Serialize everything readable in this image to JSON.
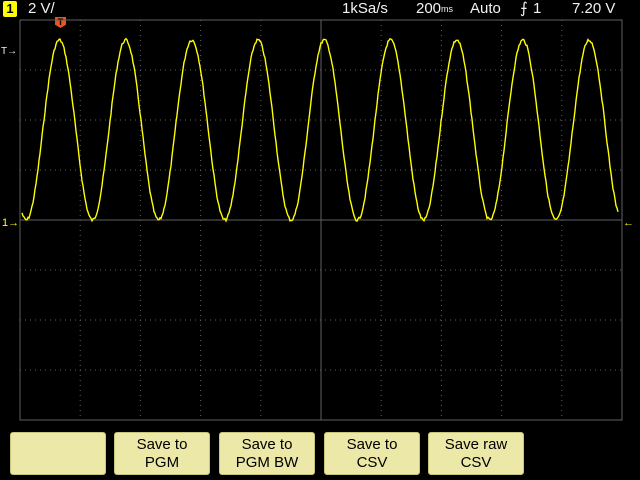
{
  "status": {
    "channel": "1",
    "scale": "2 V/",
    "sample_rate": "1kSa/s",
    "timebase_value": "200",
    "timebase_unit": "ms",
    "mode": "Auto",
    "trigger_source": "1",
    "trigger_level": "7.20 V"
  },
  "markers": {
    "trigger_pos": "T",
    "trigger_level_arrow": "T→",
    "channel_ground": "1→",
    "right_arrow": "←"
  },
  "softkeys": [
    {
      "line1": "",
      "line2": ""
    },
    {
      "line1": "Save to",
      "line2": "PGM"
    },
    {
      "line1": "Save to",
      "line2": "PGM BW"
    },
    {
      "line1": "Save to",
      "line2": "CSV"
    },
    {
      "line1": "Save raw",
      "line2": "CSV"
    }
  ],
  "colors": {
    "trace": "#ffff00",
    "grid": "#606060",
    "background": "#000000",
    "softkey": "#ebe8a8"
  },
  "waveform": {
    "cycles": 9,
    "v_div": 2,
    "high_v": 7.2,
    "low_v": 0.0
  }
}
